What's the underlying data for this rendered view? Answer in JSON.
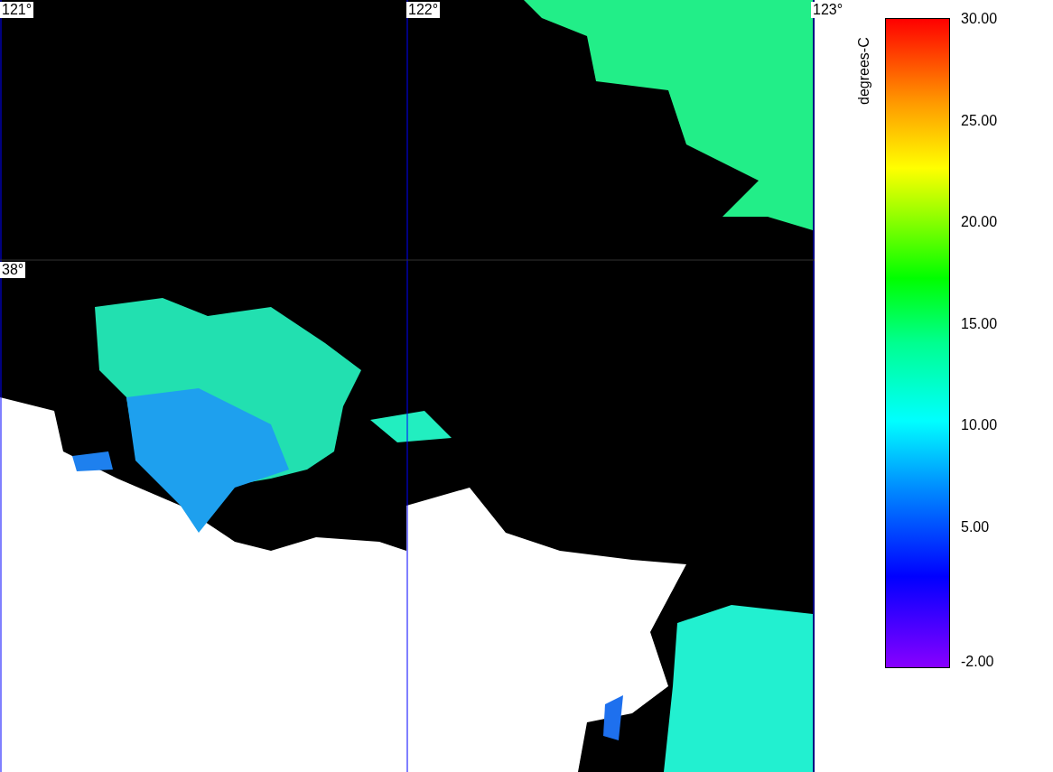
{
  "map": {
    "longitude_labels": [
      "121°",
      "122°",
      "123°"
    ],
    "latitude_labels": [
      "38°"
    ]
  },
  "legend": {
    "unit": "degrees-C",
    "ticks": [
      "30.00",
      "25.00",
      "20.00",
      "15.00",
      "10.00",
      "5.00",
      "-2.00"
    ]
  }
}
